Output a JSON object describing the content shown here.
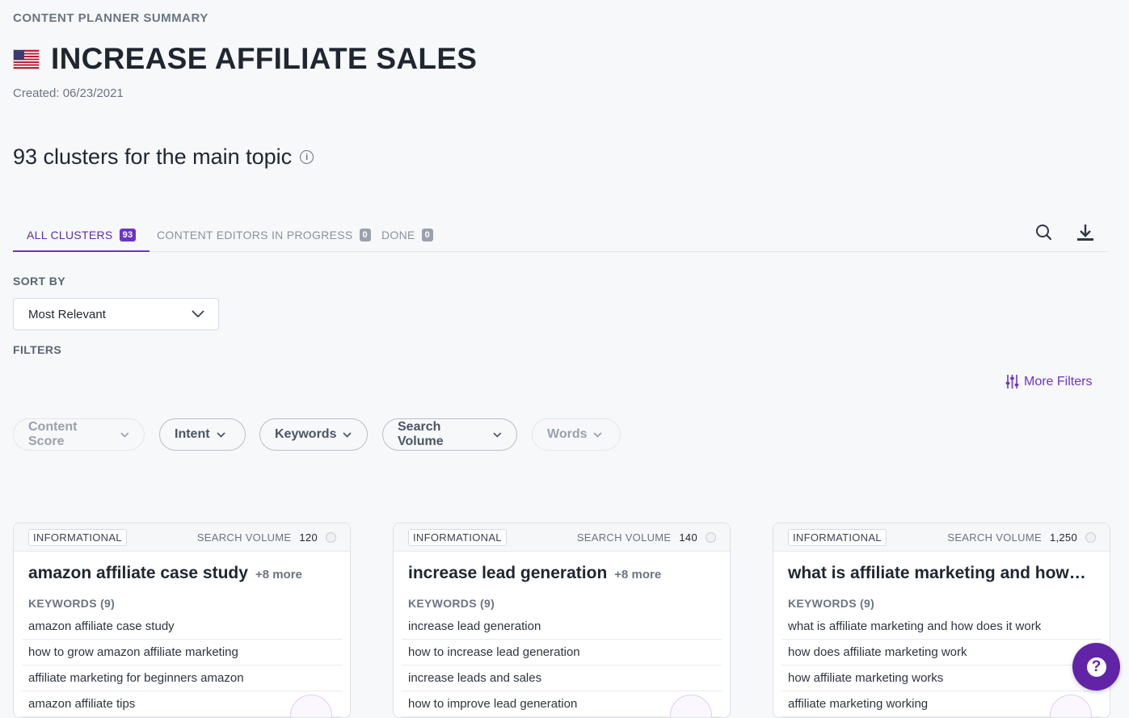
{
  "header": {
    "eyebrow": "CONTENT PLANNER SUMMARY",
    "title": "INCREASE AFFILIATE SALES",
    "flag_icon": "us-flag-icon",
    "created": "Created: 06/23/2021"
  },
  "clusters_heading": "93 clusters for the main topic",
  "tabs": [
    {
      "label": "ALL CLUSTERS",
      "count": "93",
      "active": true
    },
    {
      "label": "CONTENT EDITORS IN PROGRESS",
      "count": "0",
      "active": false
    },
    {
      "label": "DONE",
      "count": "0",
      "active": false
    }
  ],
  "toolbar": {
    "search_icon": "search-icon",
    "download_icon": "download-icon"
  },
  "sort": {
    "label": "SORT BY",
    "value": "Most Relevant"
  },
  "filters": {
    "label": "FILTERS",
    "more_filters": "More Filters",
    "chips": [
      {
        "label": "Content Score",
        "enabled": false
      },
      {
        "label": "Intent",
        "enabled": true
      },
      {
        "label": "Keywords",
        "enabled": true
      },
      {
        "label": "Search Volume",
        "enabled": true
      },
      {
        "label": "Words",
        "enabled": false
      }
    ]
  },
  "cards": [
    {
      "intent": "INFORMATIONAL",
      "sv_label": "SEARCH VOLUME",
      "sv_value": "120",
      "title": "amazon affiliate case study",
      "more": "+8 more",
      "kw_label": "KEYWORDS (9)",
      "keywords": [
        "amazon affiliate case study",
        "how to grow amazon affiliate marketing",
        "affiliate marketing for beginners amazon",
        "amazon affiliate tips"
      ]
    },
    {
      "intent": "INFORMATIONAL",
      "sv_label": "SEARCH VOLUME",
      "sv_value": "140",
      "title": "increase lead generation",
      "more": "+8 more",
      "kw_label": "KEYWORDS (9)",
      "keywords": [
        "increase lead generation",
        "how to increase lead generation",
        "increase leads and sales",
        "how to improve lead generation"
      ]
    },
    {
      "intent": "INFORMATIONAL",
      "sv_label": "SEARCH VOLUME",
      "sv_value": "1,250",
      "title": "what is affiliate marketing and how does it work",
      "more": "",
      "kw_label": "KEYWORDS (9)",
      "keywords": [
        "what is affiliate marketing and how does it work",
        "how does affiliate marketing work",
        "how affiliate marketing works",
        "affiliate marketing working"
      ]
    }
  ],
  "help": {
    "label": "?"
  },
  "colors": {
    "accent": "#6b35c8",
    "help_bg": "#6124a6"
  }
}
